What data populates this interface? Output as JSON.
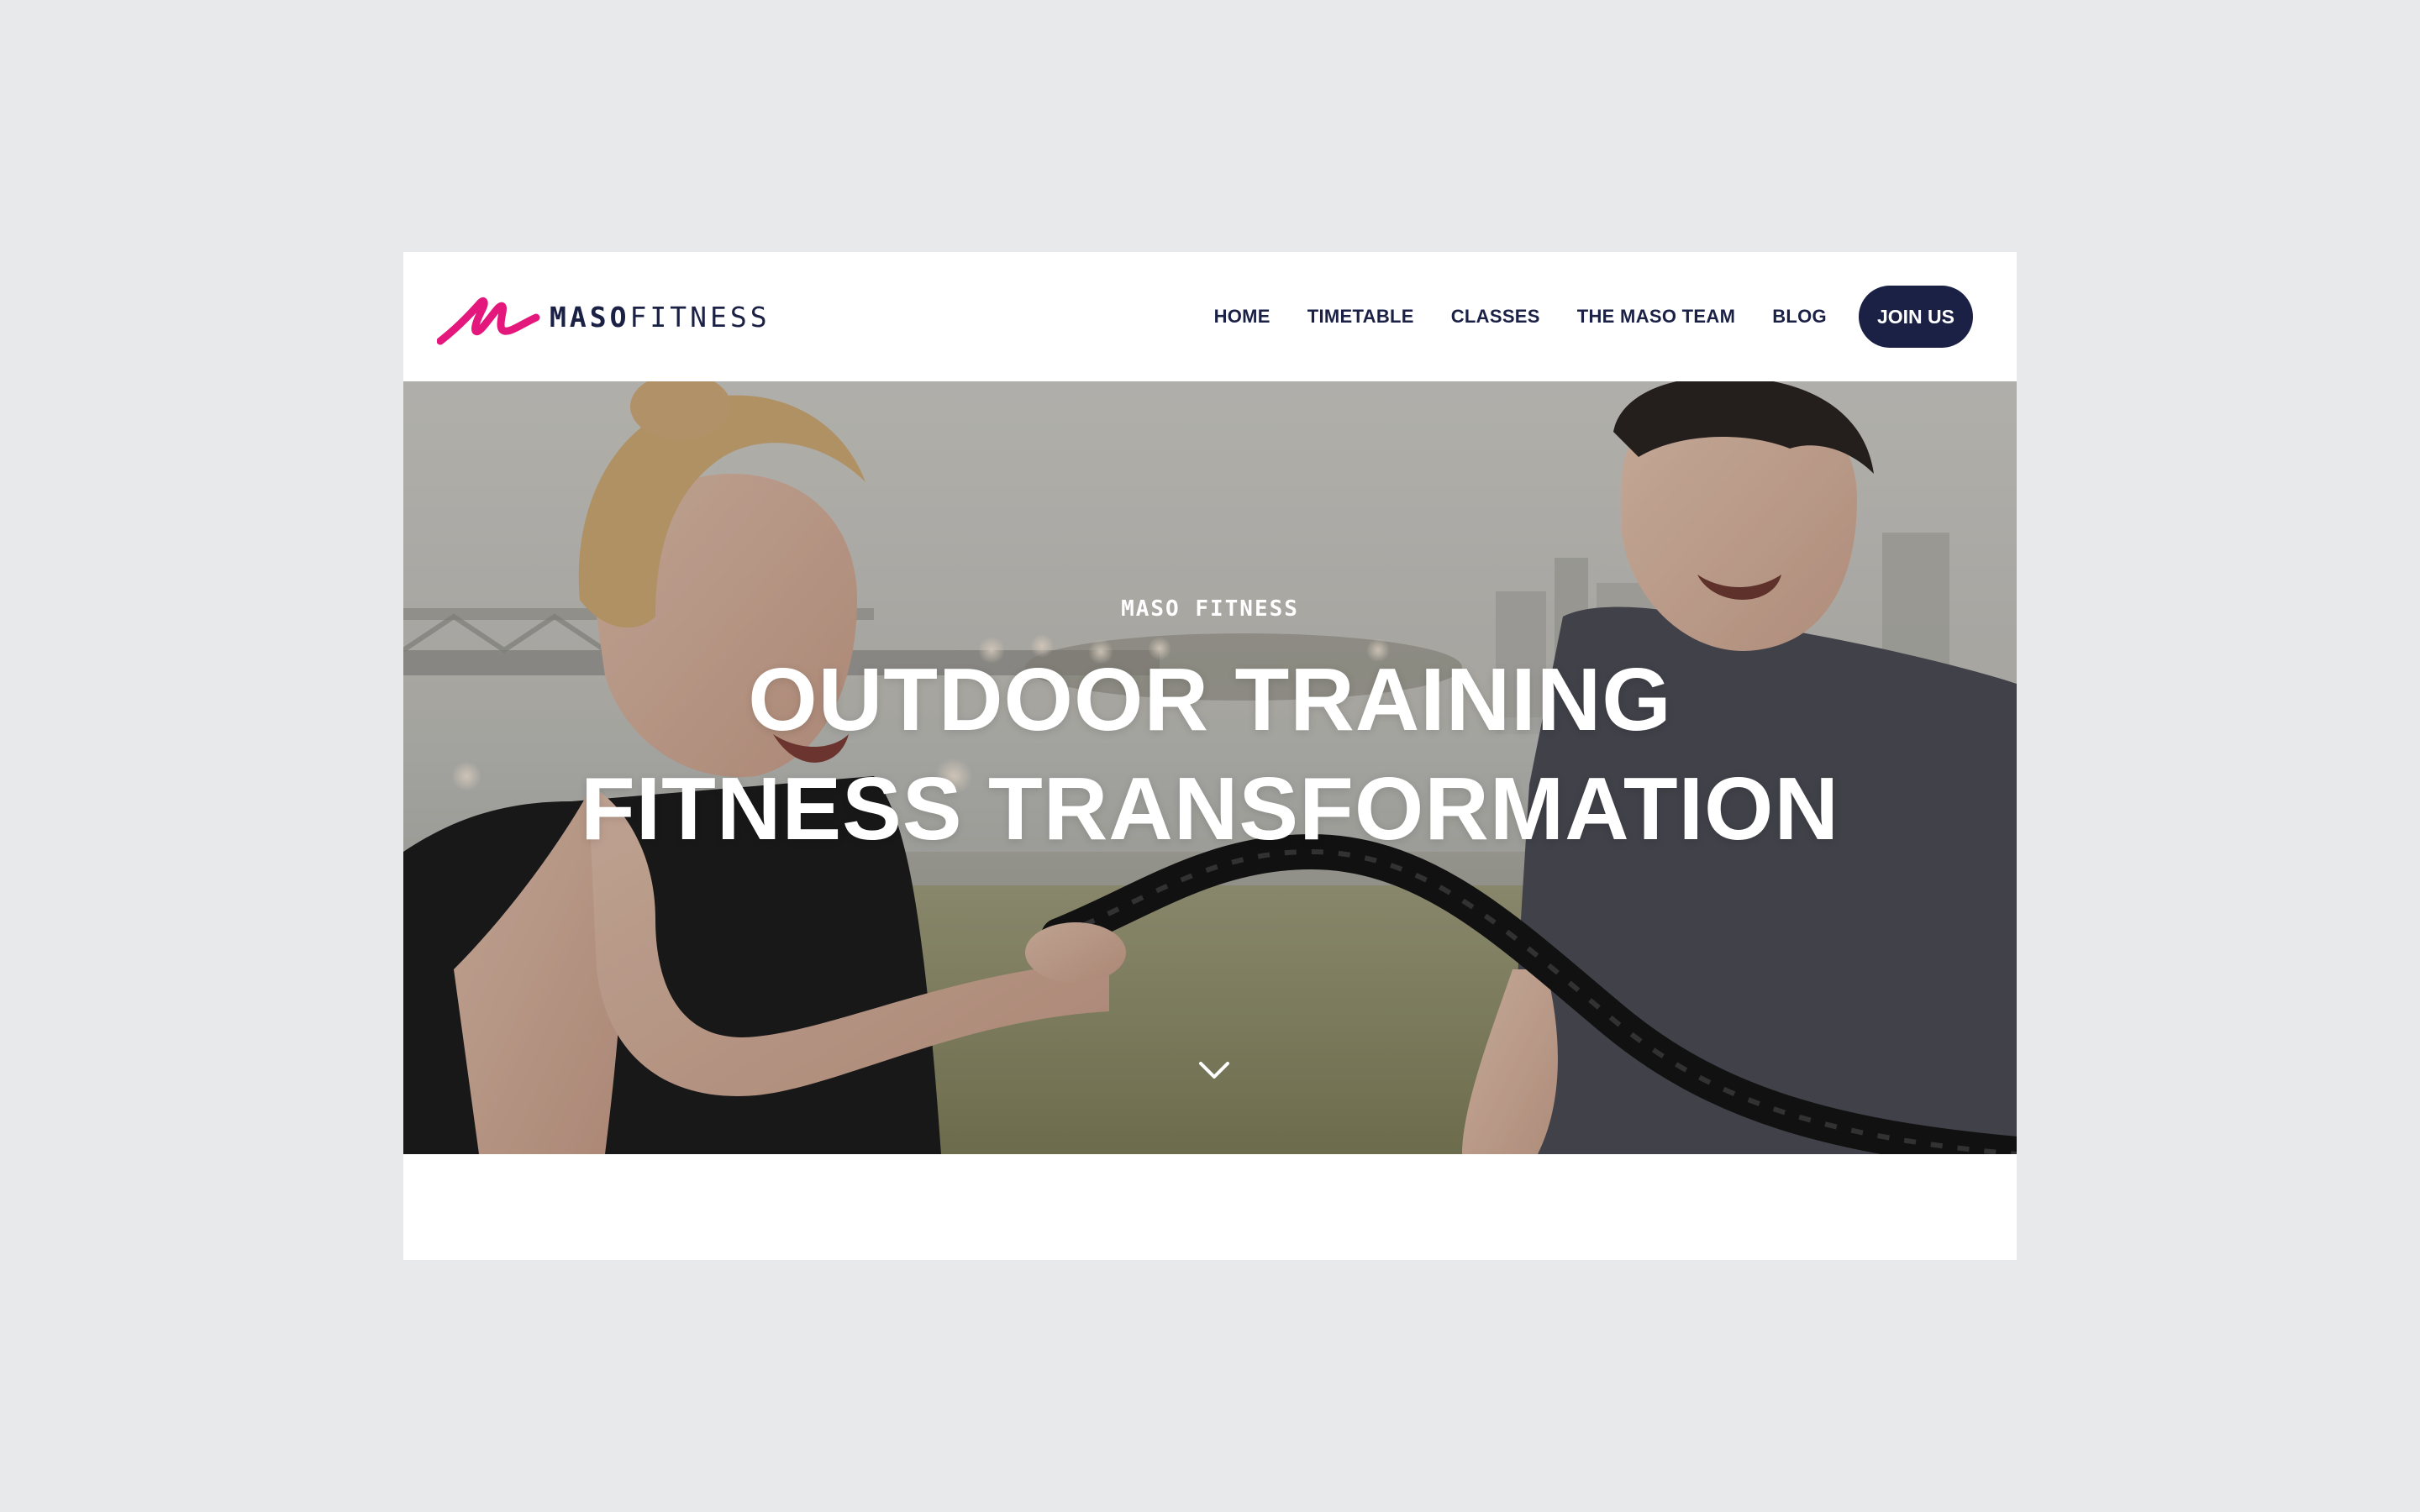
{
  "brand": {
    "logo_bold": "MASO",
    "logo_light": "FITNESS",
    "accent_color": "#e4187c",
    "navy_color": "#1b2145"
  },
  "nav": {
    "items": [
      {
        "label": "HOME"
      },
      {
        "label": "TIMETABLE"
      },
      {
        "label": "CLASSES"
      },
      {
        "label": "THE MASO TEAM"
      },
      {
        "label": "BLOG"
      }
    ],
    "cta_label": "JOIN US"
  },
  "hero": {
    "kicker": "MASO FITNESS",
    "title_line1": "OUTDOOR TRAINING",
    "title_line2": "FITNESS TRANSFORMATION",
    "scroll_icon": "chevron-down-icon"
  }
}
